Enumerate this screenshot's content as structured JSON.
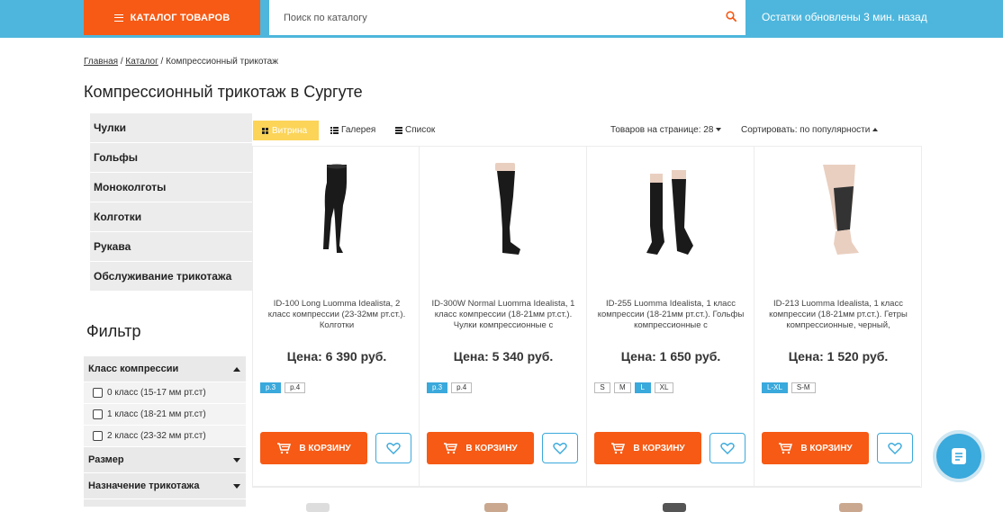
{
  "header": {
    "catalog_label": "КАТАЛОГ ТОВАРОВ",
    "search_placeholder": "Поиск по каталогу",
    "stock_note": "Остатки обновлены 3 мин. назад"
  },
  "breadcrumb": {
    "items": [
      "Главная",
      "Каталог"
    ],
    "current": "Компрессионный трикотаж",
    "separator": " / "
  },
  "page_title": "Компрессионный трикотаж в Сургуте",
  "categories": [
    "Чулки",
    "Гольфы",
    "Моноколготы",
    "Колготки",
    "Рукава",
    "Обслуживание трикотажа"
  ],
  "filter": {
    "title": "Фильтр",
    "sections": [
      {
        "label": "Класс компрессии",
        "expanded": true,
        "options": [
          "0 класс (15-17 мм рт.ст)",
          "1 класс (18-21 мм рт.ст)",
          "2 класс (23-32 мм рт.ст)"
        ]
      },
      {
        "label": "Размер",
        "expanded": false
      },
      {
        "label": "Назначение трикотажа",
        "expanded": false
      }
    ]
  },
  "toolbar": {
    "views": [
      "Витрина",
      "Галерея",
      "Список"
    ],
    "active_view": "Витрина",
    "per_page": "Товаров на странице: 28",
    "sort": "Сортировать: по популярности"
  },
  "products": [
    {
      "name": "ID-100 Long Luomma Idealista, 2 класс компрессии (23-32мм рт.ст.). Колготки",
      "price": "Цена: 6 390 руб.",
      "sizes": [
        {
          "label": "р.3",
          "active": true
        },
        {
          "label": "р.4",
          "active": false
        }
      ],
      "image": "tights-icon"
    },
    {
      "name": "ID-300W Normal Luomma Idealista, 1 класс компрессии (18-21мм рт.ст.). Чулки компрессионные с",
      "price": "Цена: 5 340 руб.",
      "sizes": [
        {
          "label": "р.3",
          "active": true
        },
        {
          "label": "р.4",
          "active": false
        }
      ],
      "image": "stocking-icon"
    },
    {
      "name": "ID-255 Luomma Idealista, 1 класс компрессии (18-21мм рт.ст.). Гольфы компрессионные с",
      "price": "Цена: 1 650 руб.",
      "sizes": [
        {
          "label": "S",
          "active": false
        },
        {
          "label": "M",
          "active": false
        },
        {
          "label": "L",
          "active": true
        },
        {
          "label": "XL",
          "active": false
        }
      ],
      "image": "knee-socks-icon"
    },
    {
      "name": "ID-213 Luomma Idealista, 1 класс компрессии (18-21мм рт.ст.). Гетры компрессионные, черный,",
      "price": "Цена: 1 520 руб.",
      "sizes": [
        {
          "label": "L-XL",
          "active": true
        },
        {
          "label": "S-M",
          "active": false
        }
      ],
      "image": "gaiters-icon"
    }
  ],
  "cart_label": "В КОРЗИНУ",
  "colors": {
    "orange": "#f65a15",
    "blue": "#3aa9dc",
    "topbar": "#4eb6dc",
    "yellow": "#fbd458"
  }
}
